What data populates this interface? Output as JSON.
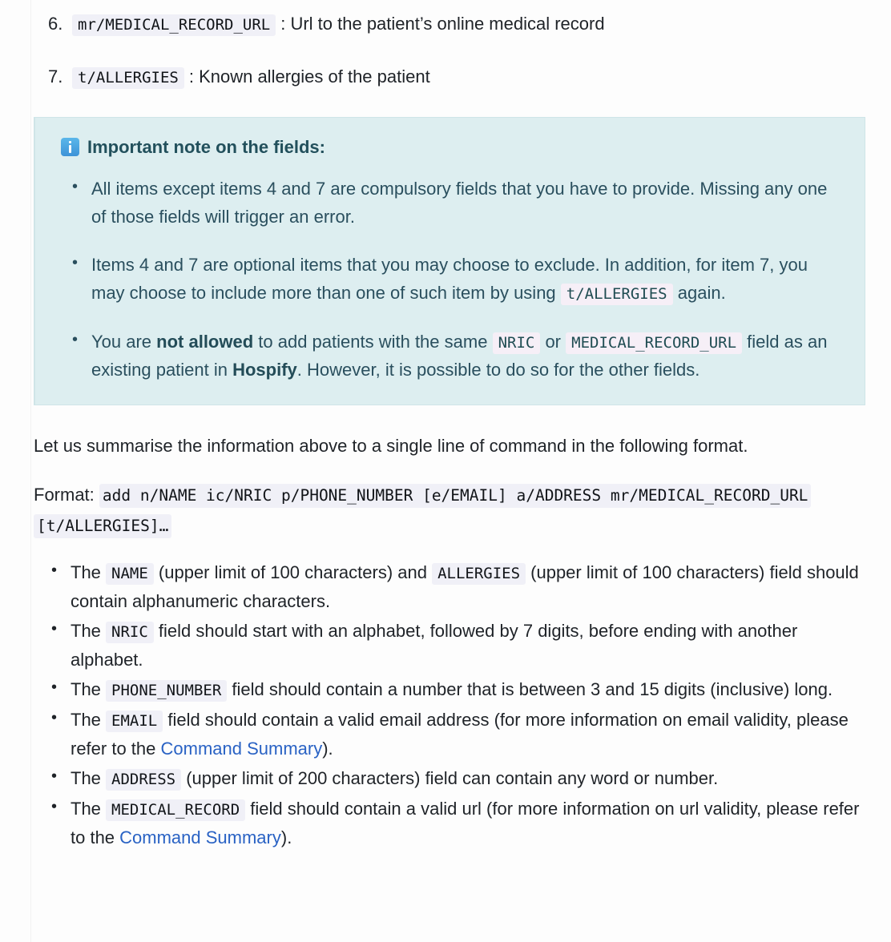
{
  "numbered_items": [
    {
      "marker": "6.",
      "code": "mr/MEDICAL_RECORD_URL",
      "desc": ": Url to the patient’s online medical record"
    },
    {
      "marker": "7.",
      "code": "t/ALLERGIES",
      "desc": ": Known allergies of the patient"
    }
  ],
  "note": {
    "icon": "info-icon",
    "title": "Important note on the fields:",
    "bullets": [
      {
        "parts": [
          {
            "type": "text",
            "value": "All items except items 4 and 7 are compulsory fields that you have to provide. Missing any one of those fields will trigger an error."
          }
        ]
      },
      {
        "parts": [
          {
            "type": "text",
            "value": "Items 4 and 7 are optional items that you may choose to exclude. In addition, for item 7, you may choose to include more than one of such item by using "
          },
          {
            "type": "code",
            "value": "t/ALLERGIES"
          },
          {
            "type": "text",
            "value": " again."
          }
        ]
      },
      {
        "parts": [
          {
            "type": "text",
            "value": "You are "
          },
          {
            "type": "bold",
            "value": "not allowed"
          },
          {
            "type": "text",
            "value": " to add patients with the same "
          },
          {
            "type": "code",
            "value": "NRIC"
          },
          {
            "type": "text",
            "value": " or "
          },
          {
            "type": "code",
            "value": "MEDICAL_RECORD_URL"
          },
          {
            "type": "text",
            "value": " field as an existing patient in "
          },
          {
            "type": "bold",
            "value": "Hospify"
          },
          {
            "type": "text",
            "value": ". However, it is possible to do so for the other fields."
          }
        ]
      }
    ]
  },
  "summary_paragraph": "Let us summarise the information above to a single line of command in the following format.",
  "format": {
    "label": "Format:",
    "command_line1": "add n/NAME ic/NRIC p/PHONE_NUMBER [e/EMAIL] a/ADDRESS mr/MEDICAL_RECORD_URL",
    "command_line2": "[t/ALLERGIES]…"
  },
  "rules": [
    {
      "parts": [
        {
          "type": "text",
          "value": "The "
        },
        {
          "type": "code",
          "value": "NAME"
        },
        {
          "type": "text",
          "value": " (upper limit of 100 characters) and "
        },
        {
          "type": "code",
          "value": "ALLERGIES"
        },
        {
          "type": "text",
          "value": " (upper limit of 100 characters) field should contain alphanumeric characters."
        }
      ]
    },
    {
      "parts": [
        {
          "type": "text",
          "value": "The "
        },
        {
          "type": "code",
          "value": "NRIC"
        },
        {
          "type": "text",
          "value": " field should start with an alphabet, followed by 7 digits, before ending with another alphabet."
        }
      ]
    },
    {
      "parts": [
        {
          "type": "text",
          "value": "The "
        },
        {
          "type": "code",
          "value": "PHONE_NUMBER"
        },
        {
          "type": "text",
          "value": " field should contain a number that is between 3 and 15 digits (inclusive) long."
        }
      ]
    },
    {
      "parts": [
        {
          "type": "text",
          "value": "The "
        },
        {
          "type": "code",
          "value": "EMAIL"
        },
        {
          "type": "text",
          "value": " field should contain a valid email address (for more information on email validity, please refer to the "
        },
        {
          "type": "link",
          "value": "Command Summary"
        },
        {
          "type": "text",
          "value": ")."
        }
      ]
    },
    {
      "parts": [
        {
          "type": "text",
          "value": "The "
        },
        {
          "type": "code",
          "value": "ADDRESS"
        },
        {
          "type": "text",
          "value": " (upper limit of 200 characters) field can contain any word or number."
        }
      ]
    },
    {
      "parts": [
        {
          "type": "text",
          "value": "The "
        },
        {
          "type": "code",
          "value": "MEDICAL_RECORD"
        },
        {
          "type": "text",
          "value": " field should contain a valid url (for more information on url validity, please refer to the "
        },
        {
          "type": "link",
          "value": "Command Summary"
        },
        {
          "type": "text",
          "value": ")."
        }
      ]
    }
  ],
  "colors": {
    "page_background": "#fdfdfd",
    "text": "#1f2328",
    "note_background": "#ddeef0",
    "note_border": "#cfe5e8",
    "note_text": "#2a4f5e",
    "code_background": "#f0f0f7",
    "note_code_background": "#f6eff7",
    "link": "#2962c4",
    "info_icon": "#3d93d8"
  }
}
